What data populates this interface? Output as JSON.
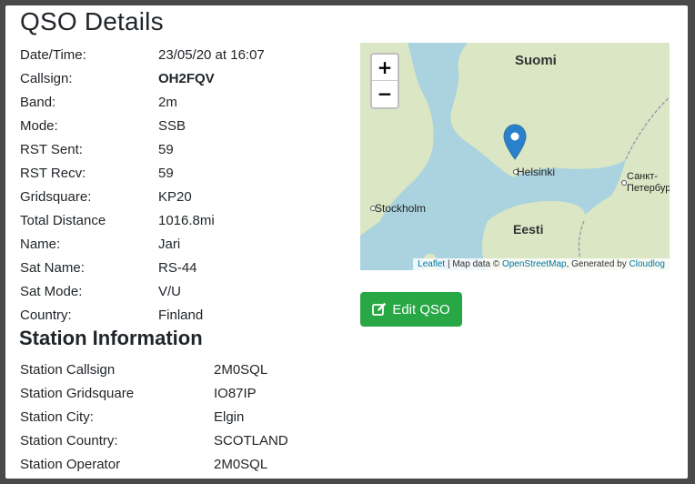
{
  "modal": {
    "title": "QSO Details"
  },
  "qso": [
    {
      "label": "Date/Time:",
      "value": "23/05/20 at 16:07"
    },
    {
      "label": "Callsign:",
      "value": "OH2FQV"
    },
    {
      "label": "Band:",
      "value": "2m"
    },
    {
      "label": "Mode:",
      "value": "SSB"
    },
    {
      "label": "RST Sent:",
      "value": "59"
    },
    {
      "label": "RST Recv:",
      "value": "59"
    },
    {
      "label": "Gridsquare:",
      "value": "KP20"
    },
    {
      "label": "Total Distance",
      "value": "1016.8mi"
    },
    {
      "label": "Name:",
      "value": "Jari"
    },
    {
      "label": "Sat Name:",
      "value": "RS-44"
    },
    {
      "label": "Sat Mode:",
      "value": "V/U"
    },
    {
      "label": "Country:",
      "value": "Finland"
    }
  ],
  "station": {
    "title": "Station Information",
    "rows": [
      {
        "label": "Station Callsign",
        "value": "2M0SQL"
      },
      {
        "label": "Station Gridsquare",
        "value": "IO87IP"
      },
      {
        "label": "Station City:",
        "value": "Elgin"
      },
      {
        "label": "Station Country:",
        "value": "SCOTLAND"
      },
      {
        "label": "Station Operator",
        "value": "2M0SQL"
      }
    ]
  },
  "map": {
    "zoom_in": "+",
    "zoom_out": "−",
    "labels": {
      "suomi": "Suomi",
      "helsinki": "Helsinki",
      "stockholm": "Stockholm",
      "eesti": "Eesti",
      "spb": "Санкт-",
      "spb2": "Петербург"
    },
    "attribution": {
      "leaflet": "Leaflet",
      "sep": " | Map data © ",
      "osm": "OpenStreetMap",
      "gen": ", Generated by ",
      "cloudlog": "Cloudlog"
    },
    "marker_color": "#2a81cb"
  },
  "actions": {
    "edit_label": "Edit QSO",
    "edit_icon": "edit-icon"
  },
  "colors": {
    "success": "#28a745",
    "sea": "#aad3df",
    "land": "#dbe6c4"
  }
}
